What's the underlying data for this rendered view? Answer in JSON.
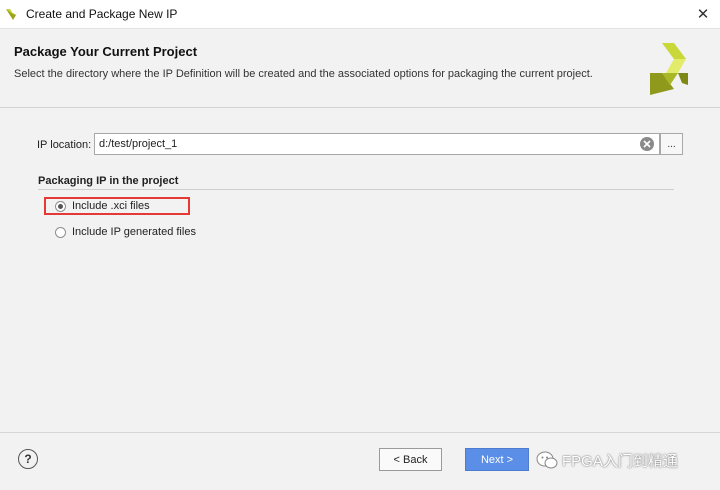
{
  "window": {
    "title": "Create and Package New IP",
    "close_glyph": "✕",
    "icon": "vivado-app-icon"
  },
  "header": {
    "heading": "Package Your Current Project",
    "description": "Select the directory where the IP Definition will be created and the associated options for packaging the current project.",
    "logo_icon": "xilinx-logo"
  },
  "ip_location": {
    "label": "IP location:",
    "value": "d:/test/project_1",
    "browse_label": "..."
  },
  "packaging": {
    "group_title": "Packaging IP in the project",
    "options": [
      {
        "label": "Include .xci files",
        "selected": true
      },
      {
        "label": "Include IP generated files",
        "selected": false
      }
    ]
  },
  "footer": {
    "help_label": "?",
    "back_label": "< Back",
    "next_label": "Next >",
    "watermark": "FPGA入门到精通"
  },
  "colors": {
    "accent_blue": "#5b8ee6",
    "highlight_red": "#e53935",
    "logo_green": "#b5c82a"
  }
}
